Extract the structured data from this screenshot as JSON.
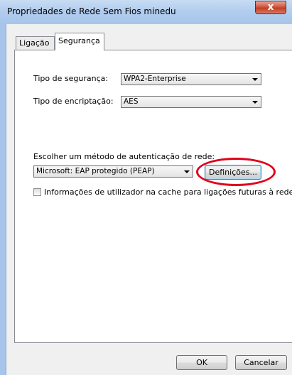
{
  "window": {
    "title": "Propriedades de Rede Sem Fios minedu",
    "close_glyph": "x"
  },
  "tabs": [
    {
      "label": "Ligação",
      "active": false
    },
    {
      "label": "Segurança",
      "active": true
    }
  ],
  "security": {
    "security_type_label": "Tipo de segurança:",
    "security_type_value": "WPA2-Enterprise",
    "encryption_type_label": "Tipo de encriptação:",
    "encryption_type_value": "AES",
    "auth_method_label": "Escolher um método de autenticação de rede:",
    "auth_method_value": "Microsoft: EAP protegido (PEAP)",
    "settings_button": "Definições...",
    "cache_checkbox_label": "Informações de utilizador na cache para ligações futuras à rede",
    "cache_checkbox_checked": false
  },
  "footer": {
    "ok_label": "OK",
    "cancel_label": "Cancelar"
  },
  "annotation": {
    "highlight_color": "#e0001a"
  }
}
